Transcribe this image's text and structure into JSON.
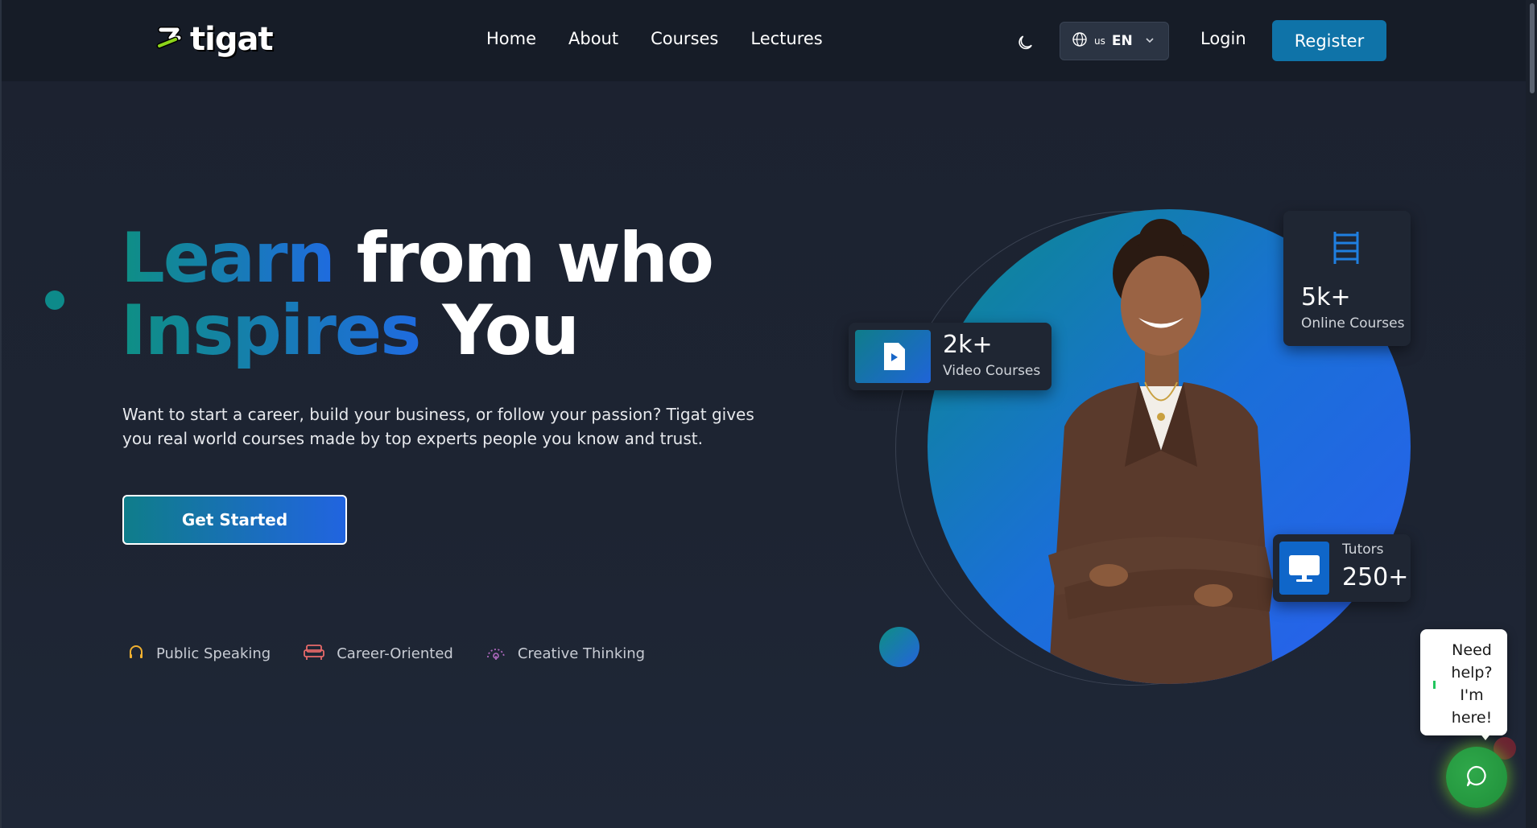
{
  "brand": {
    "name": "tigat"
  },
  "nav": {
    "links": [
      "Home",
      "About",
      "Courses",
      "Lectures"
    ],
    "language": {
      "code": "us",
      "label": "EN"
    },
    "login_label": "Login",
    "register_label": "Register"
  },
  "hero": {
    "headline": {
      "line1_accent": "Learn",
      "line1_rest": "from who",
      "line2_accent": "Inspires",
      "line2_rest": "You"
    },
    "description": "Want to start a career, build your business, or follow your passion? Tigat gives you real world courses made by top experts people you know and trust.",
    "cta_label": "Get Started",
    "features": [
      "Public Speaking",
      "Career-Oriented",
      "Creative Thinking"
    ]
  },
  "stats": {
    "video": {
      "value": "2k+",
      "label": "Video Courses"
    },
    "courses": {
      "value": "5k+",
      "label": "Online Courses"
    },
    "tutors": {
      "value": "250+",
      "label": "Tutors"
    }
  },
  "chat": {
    "message": "Need help? I'm here!"
  },
  "colors": {
    "accent_teal": "#0e8f84",
    "accent_blue": "#1f6be0",
    "register_bg": "#0f73a8",
    "chat_green": "#2fa84a"
  },
  "icons": {
    "theme_toggle": "moon-icon",
    "language": "globe-icon",
    "dropdown": "chevron-down-icon",
    "feature_1": "headphones-icon",
    "feature_2": "sofa-icon",
    "feature_3": "gauge-icon",
    "video_card": "video-file-icon",
    "courses_card": "ladder-icon",
    "tutors_card": "monitor-icon",
    "chat": "chat-icon"
  }
}
